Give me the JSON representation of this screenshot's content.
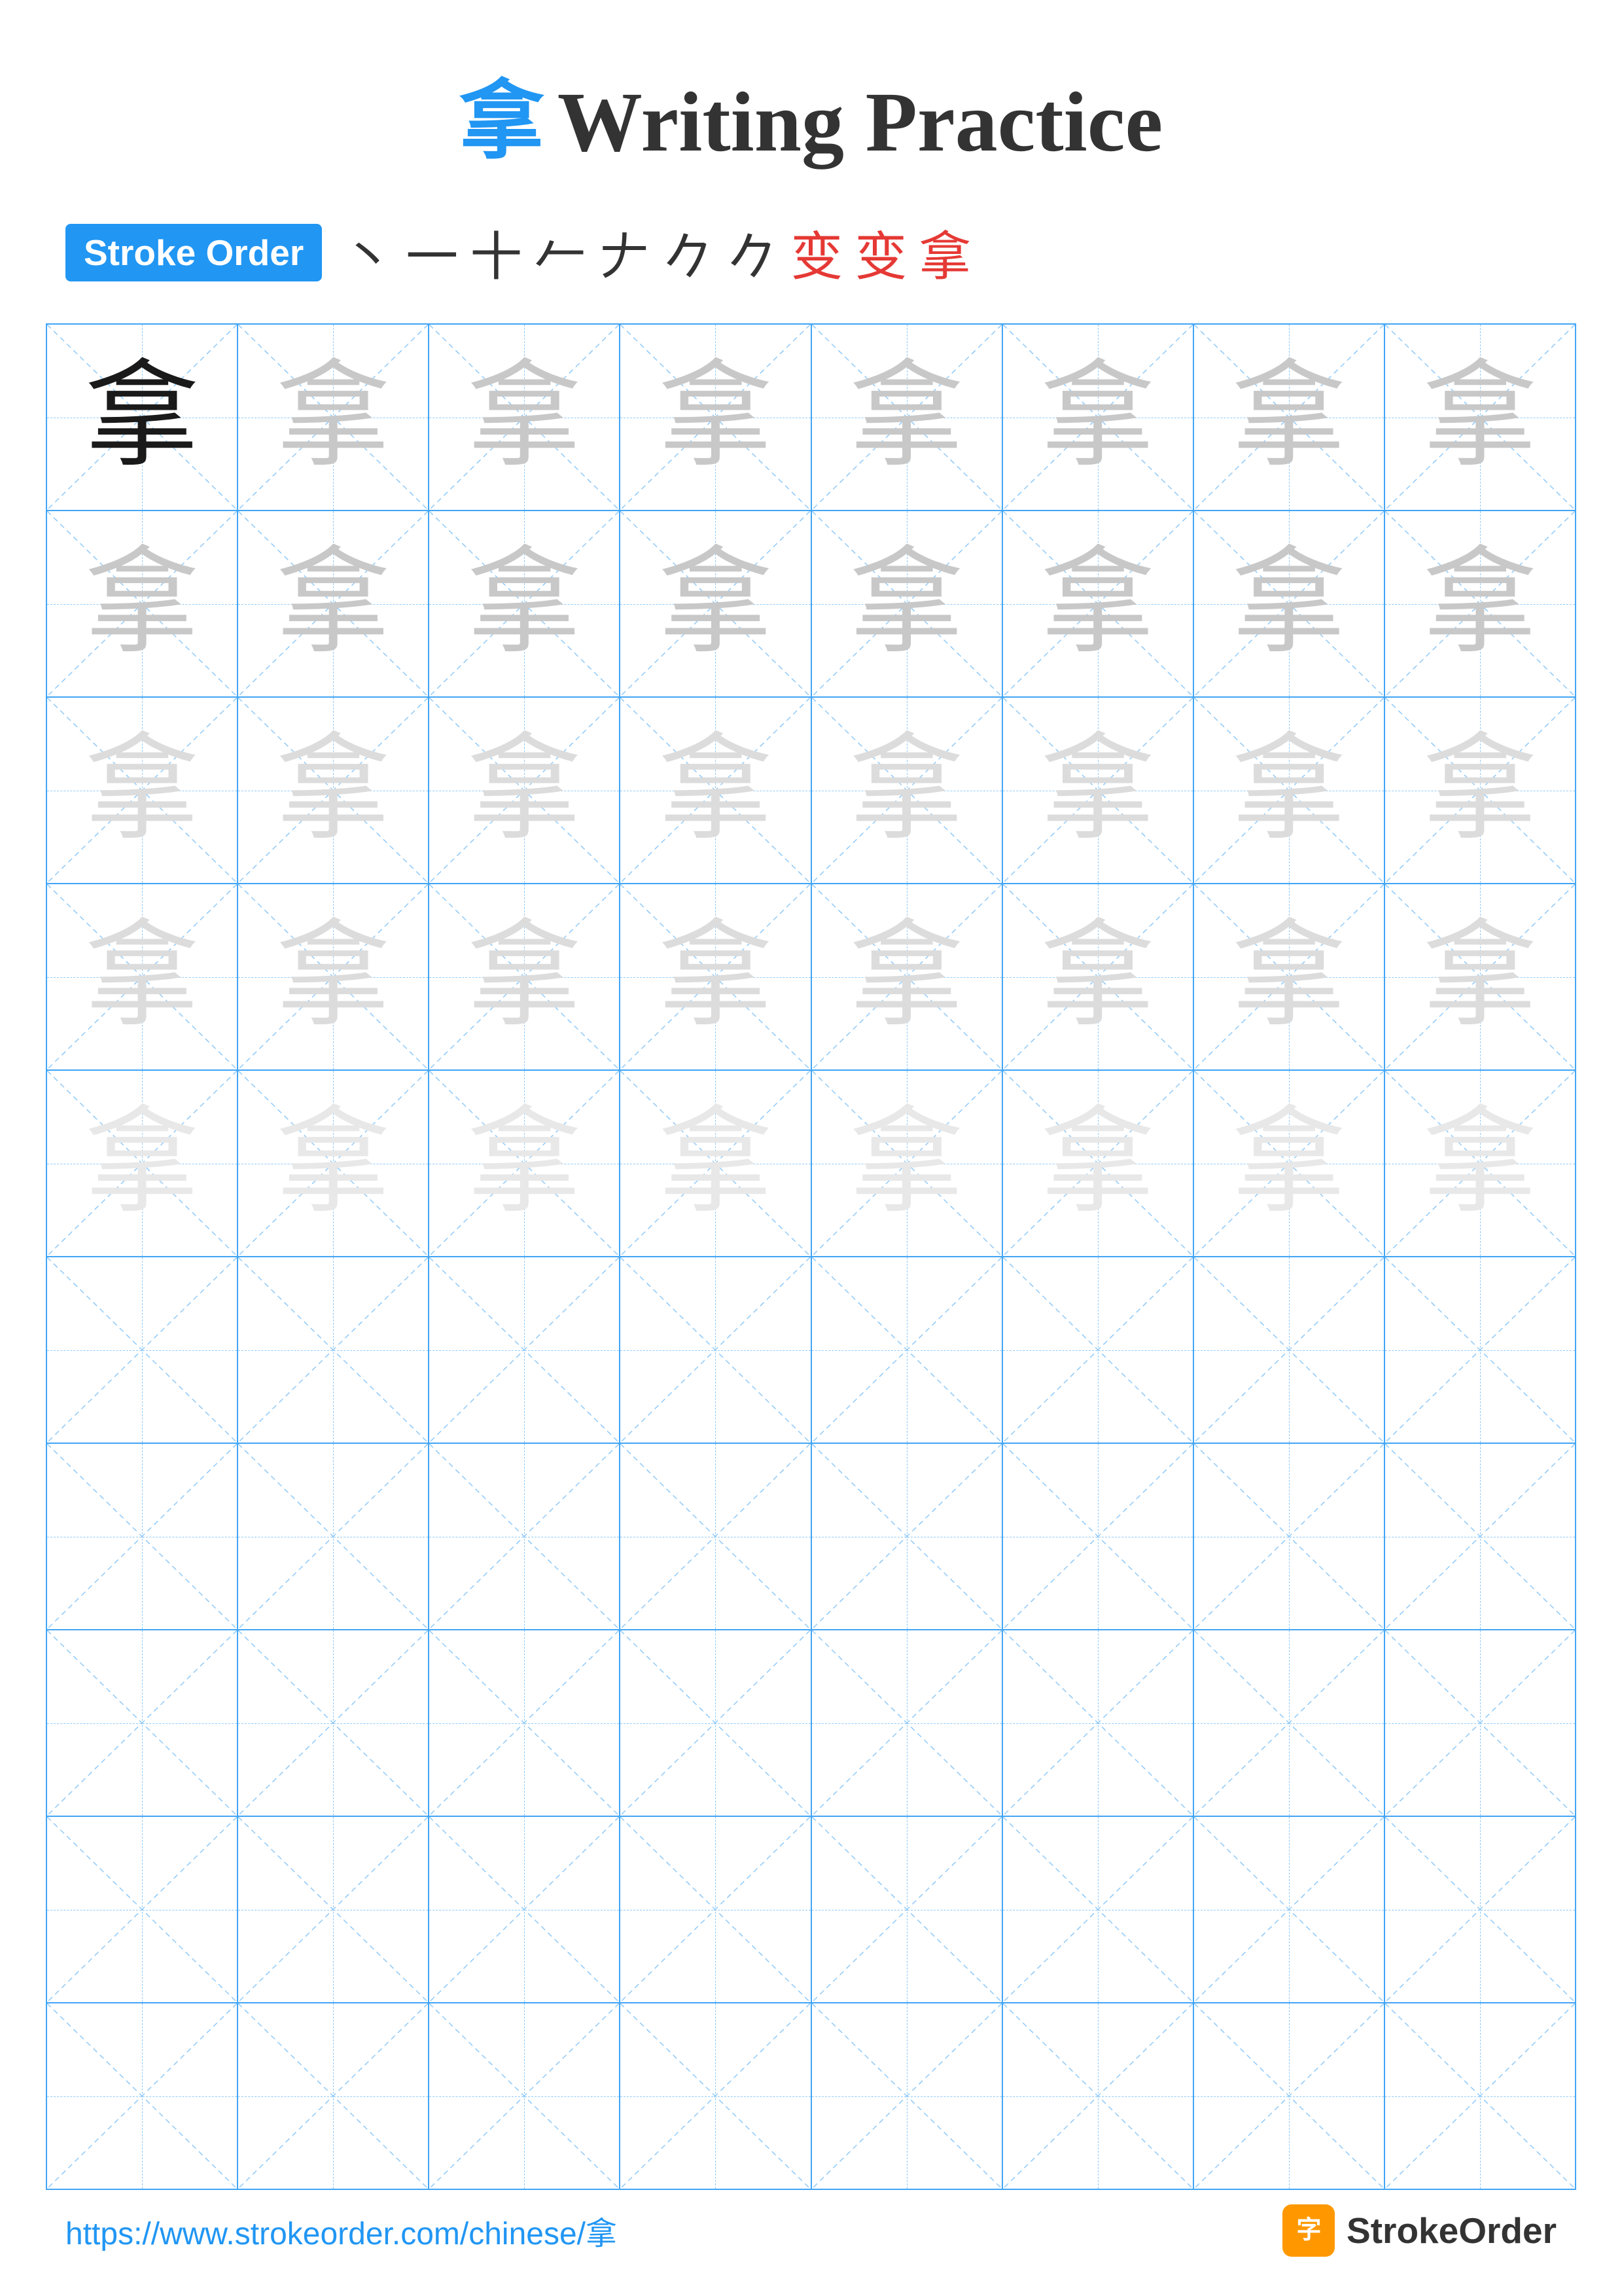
{
  "page": {
    "title": "Writing Practice",
    "main_char": "拿",
    "title_color": "#2196F3",
    "stroke_order_label": "Stroke Order",
    "stroke_order_chars": [
      "丶",
      "一",
      "十",
      "𠂉",
      "𠂉",
      "𠂊",
      "𠂊",
      "变",
      "变",
      "拿"
    ],
    "stroke_chars_colors": [
      "black",
      "black",
      "black",
      "black",
      "black",
      "black",
      "black",
      "black",
      "red",
      "red"
    ],
    "footer_url": "https://www.strokeorder.com/chinese/拿",
    "footer_brand": "StrokeOrder",
    "rows": [
      {
        "cells": [
          {
            "char": "拿",
            "style": "black"
          },
          {
            "char": "拿",
            "style": "light"
          },
          {
            "char": "拿",
            "style": "light"
          },
          {
            "char": "拿",
            "style": "light"
          },
          {
            "char": "拿",
            "style": "light"
          },
          {
            "char": "拿",
            "style": "light"
          },
          {
            "char": "拿",
            "style": "light"
          },
          {
            "char": "拿",
            "style": "light"
          }
        ]
      },
      {
        "cells": [
          {
            "char": "拿",
            "style": "light"
          },
          {
            "char": "拿",
            "style": "light"
          },
          {
            "char": "拿",
            "style": "light"
          },
          {
            "char": "拿",
            "style": "light"
          },
          {
            "char": "拿",
            "style": "light"
          },
          {
            "char": "拿",
            "style": "light"
          },
          {
            "char": "拿",
            "style": "light"
          },
          {
            "char": "拿",
            "style": "light"
          }
        ]
      },
      {
        "cells": [
          {
            "char": "拿",
            "style": "very-light"
          },
          {
            "char": "拿",
            "style": "very-light"
          },
          {
            "char": "拿",
            "style": "very-light"
          },
          {
            "char": "拿",
            "style": "very-light"
          },
          {
            "char": "拿",
            "style": "very-light"
          },
          {
            "char": "拿",
            "style": "very-light"
          },
          {
            "char": "拿",
            "style": "very-light"
          },
          {
            "char": "拿",
            "style": "very-light"
          }
        ]
      },
      {
        "cells": [
          {
            "char": "拿",
            "style": "very-light"
          },
          {
            "char": "拿",
            "style": "very-light"
          },
          {
            "char": "拿",
            "style": "very-light"
          },
          {
            "char": "拿",
            "style": "very-light"
          },
          {
            "char": "拿",
            "style": "very-light"
          },
          {
            "char": "拿",
            "style": "very-light"
          },
          {
            "char": "拿",
            "style": "very-light"
          },
          {
            "char": "拿",
            "style": "very-light"
          }
        ]
      },
      {
        "cells": [
          {
            "char": "拿",
            "style": "ultra-light"
          },
          {
            "char": "拿",
            "style": "ultra-light"
          },
          {
            "char": "拿",
            "style": "ultra-light"
          },
          {
            "char": "拿",
            "style": "ultra-light"
          },
          {
            "char": "拿",
            "style": "ultra-light"
          },
          {
            "char": "拿",
            "style": "ultra-light"
          },
          {
            "char": "拿",
            "style": "ultra-light"
          },
          {
            "char": "拿",
            "style": "ultra-light"
          }
        ]
      },
      {
        "empty": true
      },
      {
        "empty": true
      },
      {
        "empty": true
      },
      {
        "empty": true
      },
      {
        "empty": true
      }
    ]
  }
}
